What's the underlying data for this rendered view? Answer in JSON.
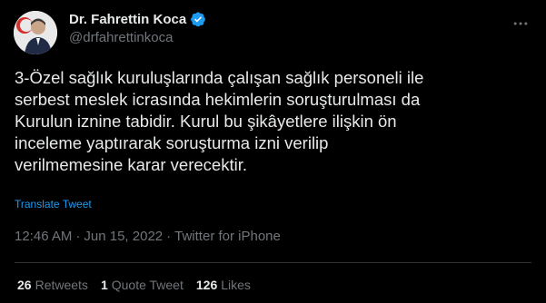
{
  "author": {
    "display_name": "Dr. Fahrettin Koca",
    "handle": "@drfahrettinkoca",
    "verified": true
  },
  "tweet": {
    "text": "3-Özel sağlık kuruluşlarında çalışan sağlık personeli ile\nserbest meslek icrasında hekimlerin soruşturulması da\nKurulun iznine tabidir. Kurul bu şikâyetlere ilişkin ön\ninceleme yaptırarak soruşturma izni verilip\nverilmemesine karar verecektir.",
    "translate_label": "Translate Tweet",
    "time": "12:46 AM",
    "date": "Jun 15, 2022",
    "source": "Twitter for iPhone",
    "separator": "·"
  },
  "stats": {
    "retweets": {
      "count": "26",
      "label": "Retweets"
    },
    "quotes": {
      "count": "1",
      "label": "Quote Tweet"
    },
    "likes": {
      "count": "126",
      "label": "Likes"
    }
  },
  "colors": {
    "background": "#000000",
    "text": "#e7e9ea",
    "muted": "#71767b",
    "link": "#1d9bf0",
    "verified": "#1d9bf0"
  },
  "icons": {
    "verified": "verified-badge-icon",
    "more": "more-options-icon"
  }
}
